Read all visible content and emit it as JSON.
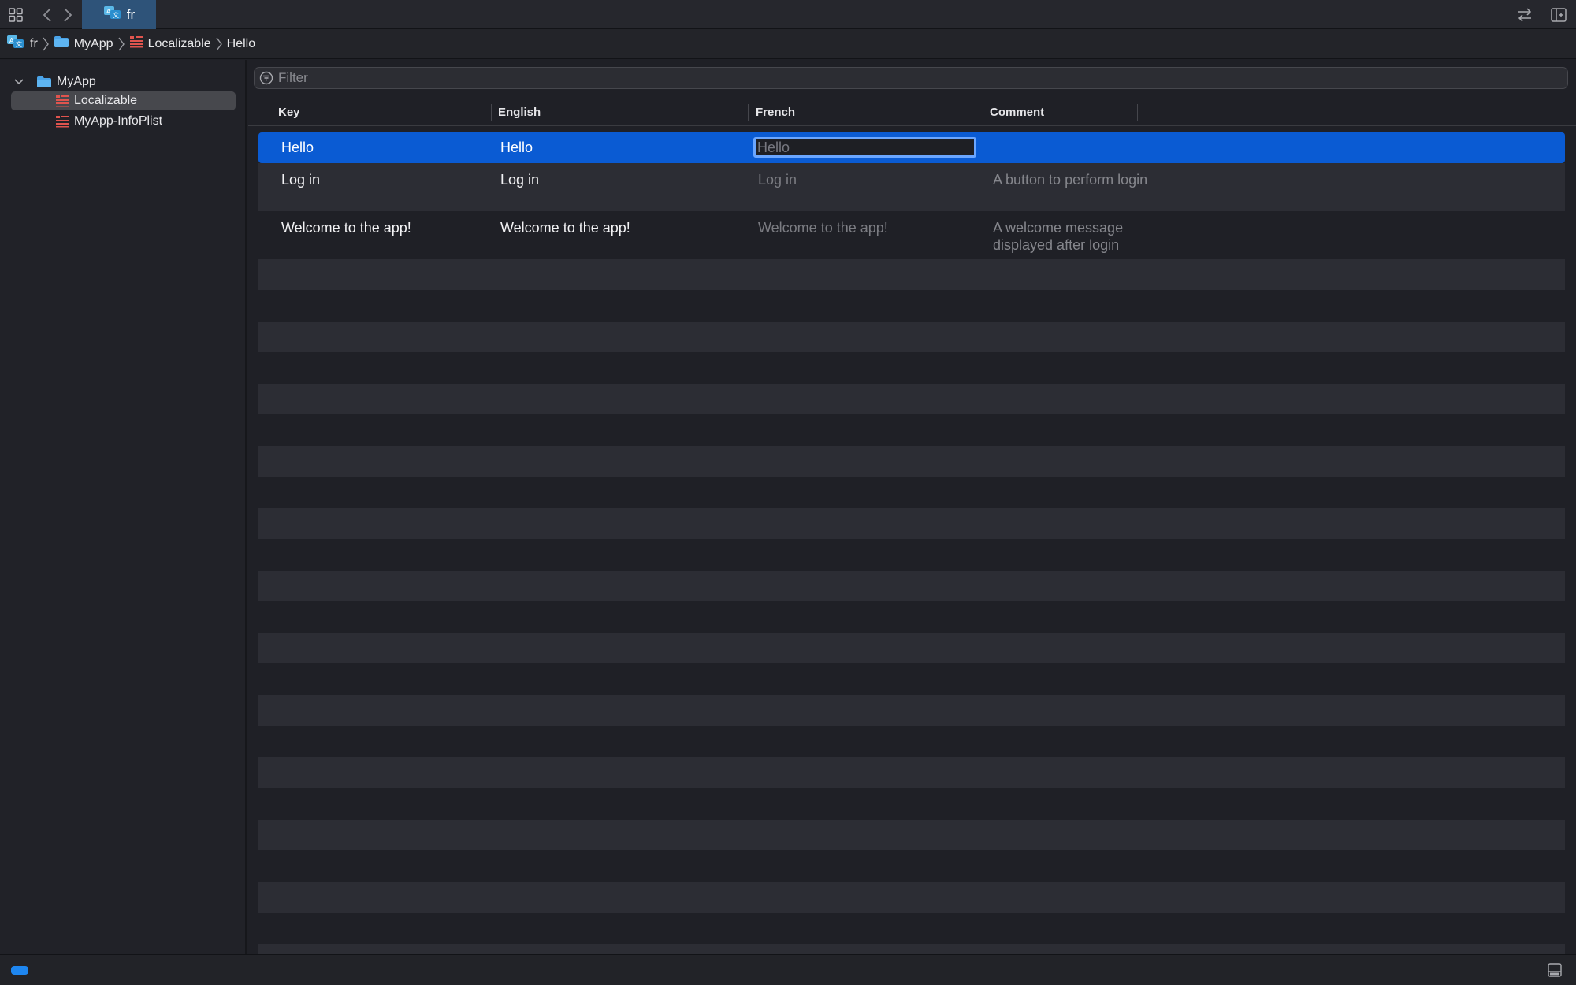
{
  "tab": {
    "label": "fr"
  },
  "breadcrumb": [
    {
      "label": "fr",
      "icon": "translate-icon"
    },
    {
      "label": "MyApp",
      "icon": "folder-icon"
    },
    {
      "label": "Localizable",
      "icon": "strings-file-icon"
    },
    {
      "label": "Hello"
    }
  ],
  "sidebar": {
    "root": {
      "label": "MyApp",
      "icon": "folder-icon",
      "expanded": true
    },
    "items": [
      {
        "label": "Localizable",
        "icon": "strings-file-icon",
        "selected": true
      },
      {
        "label": "MyApp-InfoPlist",
        "icon": "strings-file-icon",
        "selected": false
      }
    ]
  },
  "filter": {
    "placeholder": "Filter",
    "value": ""
  },
  "table": {
    "columns": [
      "Key",
      "English",
      "French",
      "Comment"
    ],
    "rows": [
      {
        "key": "Hello",
        "english": "Hello",
        "french": "Hello",
        "comment": "",
        "selected": true,
        "editing": true
      },
      {
        "key": "Log in",
        "english": "Log in",
        "french": "Log in",
        "comment": "A button to perform login",
        "selected": false
      },
      {
        "key": "Welcome to the app!",
        "english": "Welcome to the app!",
        "french": "Welcome to the app!",
        "comment": "A welcome message displayed after login",
        "selected": false
      }
    ]
  },
  "colors": {
    "accent": "#0a5bd3",
    "tab_active": "#2e5379",
    "folder": "#4aa3e8",
    "strings_file": "#e0544e",
    "background": "#1f2026",
    "stripe": "#2c2d34"
  }
}
